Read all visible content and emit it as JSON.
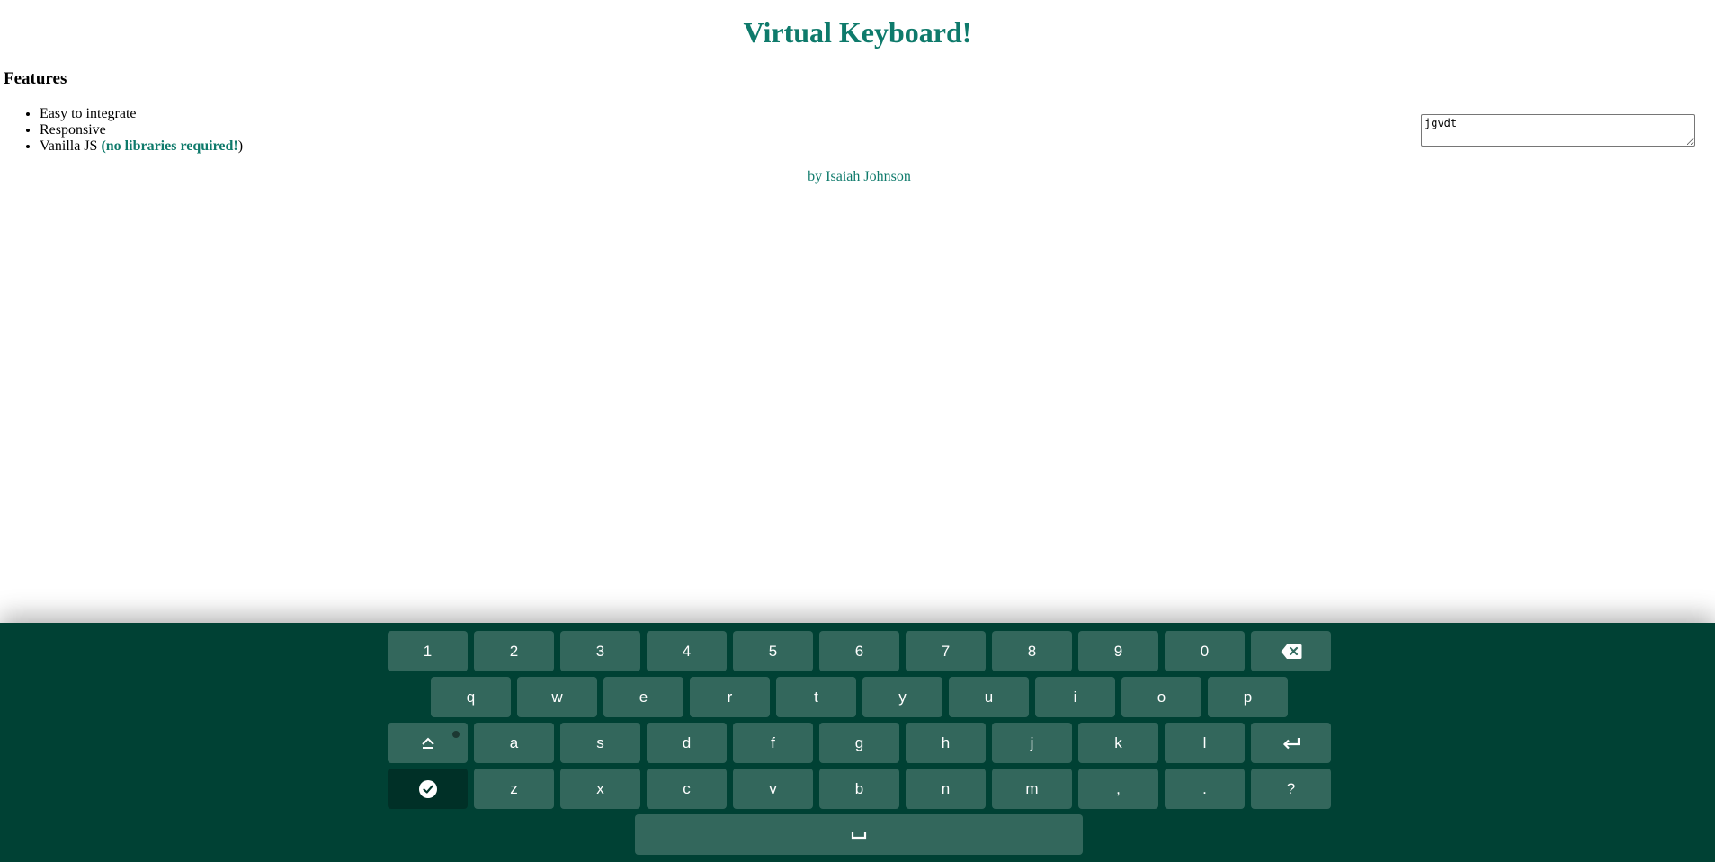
{
  "header": {
    "title": "Virtual Keyboard!"
  },
  "features": {
    "heading": "Features",
    "items": [
      "Easy to integrate",
      "Responsive"
    ],
    "vanilla": {
      "prefix": "Vanilla JS ",
      "open": "(",
      "highlight": "no libraries required!",
      "close": ")"
    }
  },
  "author": {
    "prefix": "by ",
    "name": "Isaiah Johnson"
  },
  "textarea": {
    "value": "jgvdt"
  },
  "keyboard": {
    "row1": [
      "1",
      "2",
      "3",
      "4",
      "5",
      "6",
      "7",
      "8",
      "9",
      "0"
    ],
    "row2": [
      "q",
      "w",
      "e",
      "r",
      "t",
      "y",
      "u",
      "i",
      "o",
      "p"
    ],
    "row3": [
      "a",
      "s",
      "d",
      "f",
      "g",
      "h",
      "j",
      "k",
      "l"
    ],
    "row4": [
      "z",
      "x",
      "c",
      "v",
      "b",
      "n",
      "m",
      ",",
      ".",
      "?"
    ],
    "icons": {
      "backspace": "backspace-icon",
      "caps": "caps-lock-icon",
      "enter": "enter-icon",
      "done": "check-circle-icon",
      "space": "space-icon"
    }
  },
  "colors": {
    "accent": "#0e7a6b",
    "keyboard_bg": "#004134",
    "key_bg": "#336d61"
  }
}
